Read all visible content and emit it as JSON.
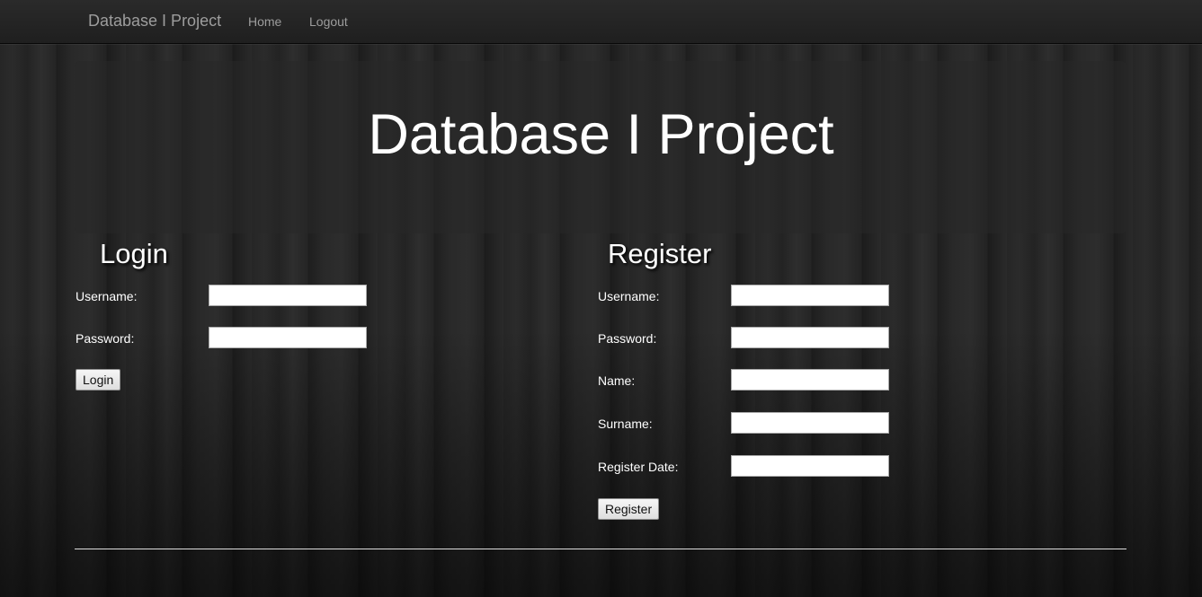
{
  "navbar": {
    "brand": "Database I Project",
    "links": [
      {
        "label": "Home"
      },
      {
        "label": "Logout"
      }
    ]
  },
  "jumbotron": {
    "title": "Database I Project"
  },
  "login": {
    "title": "Login",
    "fields": [
      {
        "label": "Username:",
        "value": ""
      },
      {
        "label": "Password:",
        "value": ""
      }
    ],
    "button": "Login"
  },
  "register": {
    "title": "Register",
    "fields": [
      {
        "label": "Username:",
        "value": ""
      },
      {
        "label": "Password:",
        "value": ""
      },
      {
        "label": "Name:",
        "value": ""
      },
      {
        "label": "Surname:",
        "value": ""
      },
      {
        "label": "Register Date:",
        "value": ""
      }
    ],
    "button": "Register"
  },
  "colors": {
    "background": "#1f1f1f",
    "navbar": "#222222",
    "nav_text": "#9d9d9d",
    "text": "#ffffff"
  }
}
